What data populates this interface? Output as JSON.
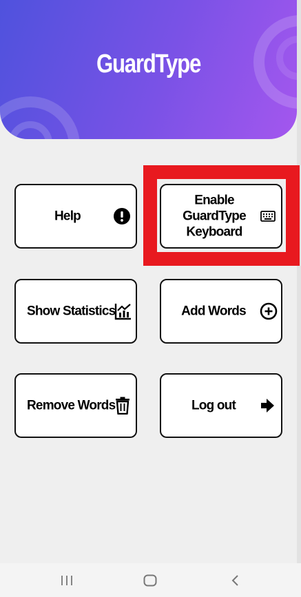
{
  "app": {
    "title": "GuardType"
  },
  "colors": {
    "header_start": "#4f52dd",
    "header_end": "#a457ee",
    "highlight": "#e8191f"
  },
  "buttons": {
    "help": {
      "label": "Help",
      "icon": "exclamation-circle-icon"
    },
    "enable_keyboard": {
      "label": "Enable GuardType Keyboard",
      "icon": "keyboard-icon"
    },
    "show_statistics": {
      "label": "Show Statistics",
      "icon": "chart-icon"
    },
    "add_words": {
      "label": "Add Words",
      "icon": "plus-circle-icon"
    },
    "remove_words": {
      "label": "Remove Words",
      "icon": "trash-icon"
    },
    "log_out": {
      "label": "Log out",
      "icon": "arrow-right-icon"
    }
  },
  "navbar": {
    "items": [
      "recent-apps-icon",
      "home-icon",
      "back-icon"
    ]
  }
}
